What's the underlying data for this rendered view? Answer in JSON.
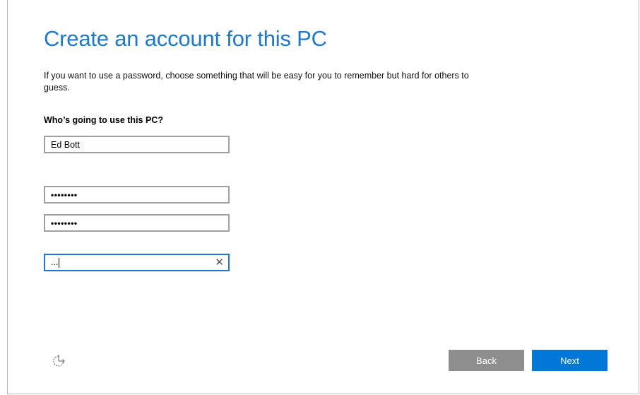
{
  "header": {
    "title": "Create an account for this PC",
    "description": "If you want to use a password, choose something that will be easy for you to remember but hard for others to guess."
  },
  "form": {
    "question": "Who’s going to use this PC?",
    "username_value": "Ed Bott",
    "password_value": "••••••••",
    "reenter_password_value": "••••••••",
    "hint_value": "..."
  },
  "footer": {
    "back_label": "Back",
    "next_label": "Next"
  },
  "icons": {
    "clear": "close-icon",
    "accessibility": "ease-of-access-icon"
  },
  "colors": {
    "accent": "#1b79d1",
    "next_button": "#0078d7",
    "back_button": "#8e8e8e"
  }
}
